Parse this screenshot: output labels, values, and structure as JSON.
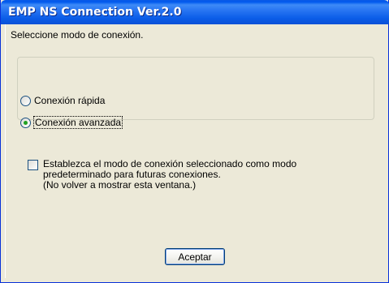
{
  "window": {
    "title": "EMP NS Connection Ver.2.0"
  },
  "prompt": "Seleccione modo de conexión.",
  "connection_modes": {
    "options": [
      {
        "label": "Conexión rápida",
        "checked": false
      },
      {
        "label": "Conexión avanzada",
        "checked": true
      }
    ]
  },
  "default_checkbox": {
    "checked": false,
    "lines": [
      "Establezca el modo de conexión seleccionado como modo",
      "predeterminado para futuras conexiones.",
      "(No volver a mostrar esta ventana.)"
    ]
  },
  "buttons": {
    "accept_label": "Aceptar"
  },
  "colors": {
    "title_bar": "#0a5ae6",
    "face": "#ece9d8",
    "radio_dot": "#21a121"
  }
}
